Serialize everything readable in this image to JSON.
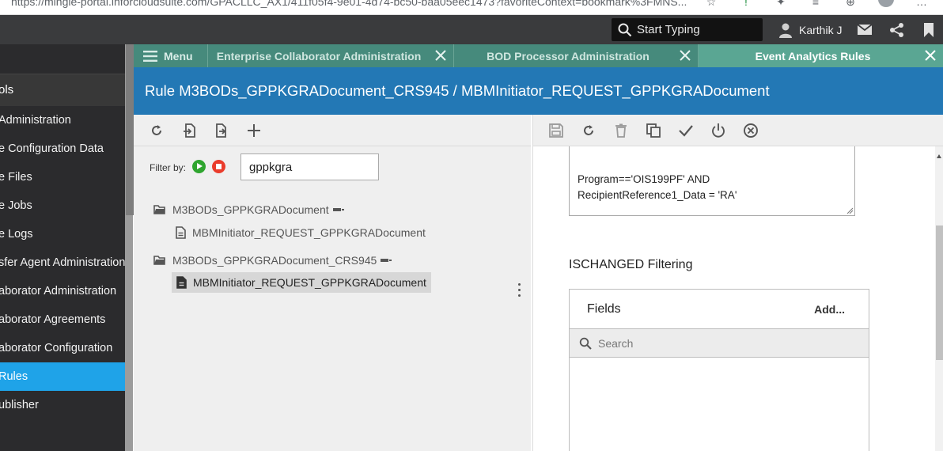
{
  "browser": {
    "url": "https://mingle-portal.inforcloudsuite.com/GPACLLC_AX1/411f05f4-9e01-4d74-bc50-baa05eec1473?favoriteContext=bookmark%3FMNS..."
  },
  "header": {
    "search_placeholder": "Start Typing",
    "user_name": "Karthik J"
  },
  "sidebar": {
    "section": "ols",
    "items": [
      {
        "label": "Administration",
        "active": false
      },
      {
        "label": "e Configuration Data",
        "active": false
      },
      {
        "label": "e Files",
        "active": false
      },
      {
        "label": "e Jobs",
        "active": false
      },
      {
        "label": "e Logs",
        "active": false
      },
      {
        "label": "sfer Agent Administration",
        "active": false
      },
      {
        "label": "aborator Administration",
        "active": false
      },
      {
        "label": "aborator Agreements",
        "active": false
      },
      {
        "label": "aborator Configuration",
        "active": false
      },
      {
        "label": "Rules",
        "active": true
      },
      {
        "label": "ublisher",
        "active": false
      }
    ]
  },
  "tabs": {
    "menu_label": "Menu",
    "items": [
      {
        "label": "Enterprise Collaborator Administration",
        "active": false
      },
      {
        "label": "BOD Processor Administration",
        "active": false
      },
      {
        "label": "Event Analytics Rules",
        "active": true
      }
    ]
  },
  "page": {
    "title": "Rule M3BODs_GPPKGRADocument_CRS945 / MBMInitiator_REQUEST_GPPKGRADocument"
  },
  "left": {
    "filter_label": "Filter by:",
    "filter_value": "gppkgra",
    "tree": [
      {
        "label": "M3BODs_GPPKGRADocument",
        "type": "folder"
      },
      {
        "label": "MBMInitiator_REQUEST_GPPKGRADocument",
        "type": "document",
        "selected": false
      },
      {
        "label": "M3BODs_GPPKGRADocument_CRS945",
        "type": "folder"
      },
      {
        "label": "MBMInitiator_REQUEST_GPPKGRADocument",
        "type": "document",
        "selected": true
      }
    ]
  },
  "right": {
    "condition_text": "Program=='OIS199PF'  AND\nRecipientReference1_Data = 'RA'",
    "section_title": "ISCHANGED Filtering",
    "fields_title": "Fields",
    "fields_add": "Add...",
    "fields_search_placeholder": "Search"
  },
  "colors": {
    "tabbar": "#468a7c",
    "tab_active": "#5aa693",
    "titlebar": "#2378b5",
    "sidebar_active": "#1fa3e8",
    "filter_play": "#2fa52f",
    "filter_stop": "#ea3c2c"
  }
}
